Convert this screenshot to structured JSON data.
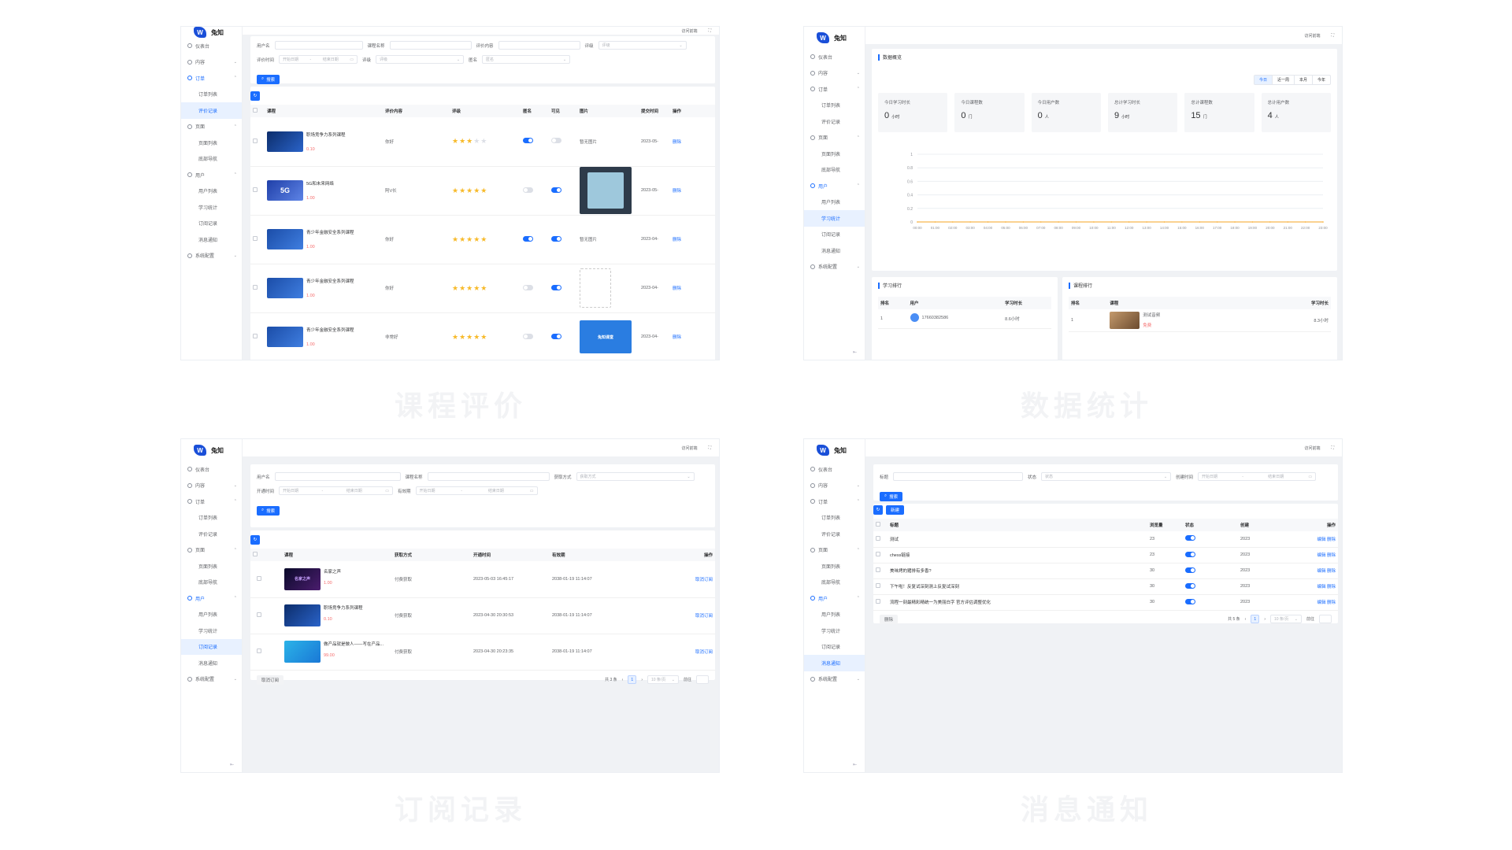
{
  "captions": [
    "课程评价",
    "数据统计",
    "订阅记录",
    "消息通知"
  ],
  "logo_text": "兔知",
  "logo_mark": "W",
  "header_right": "访问前端",
  "menu": {
    "dashboard": "仪表台",
    "content": "内容",
    "order": "订单",
    "order_list": "订单列表",
    "reviews": "评价记录",
    "pages": "页面",
    "page_list": "页面列表",
    "bottom_nav": "底部导航",
    "user": "用户",
    "user_list": "用户列表",
    "study_stats": "学习统计",
    "sub_records": "订阅记录",
    "notify": "消息通知",
    "settings": "系统配置"
  },
  "p1": {
    "filters": {
      "username": "用户名",
      "course": "课程名称",
      "content": "评价内容",
      "rating": "评级",
      "rating_ph": "评级",
      "time": "评价时间",
      "start": "开始日期",
      "end": "结束日期",
      "rating2": "评级",
      "anon": "匿名",
      "anon_ph": "匿名",
      "to": "-"
    },
    "search": "搜索",
    "cols": [
      "课程",
      "评价内容",
      "评级",
      "匿名",
      "可见",
      "图片",
      "提交时间",
      "操作"
    ],
    "rows": [
      {
        "title": "职场竞争力系列课程",
        "price": "0.10",
        "content": "你好",
        "stars": 3,
        "anon": true,
        "visible": false,
        "img": "暂无图片",
        "time": "2023-05-",
        "op": "删除"
      },
      {
        "title": "5G和未来网络",
        "price": "1.00",
        "content": "阿V长",
        "stars": 5,
        "anon": false,
        "visible": true,
        "img": "",
        "time": "2023-05-",
        "op": "删除"
      },
      {
        "title": "青少年金融安全系列课程",
        "price": "1.00",
        "content": "你好",
        "stars": 5,
        "anon": true,
        "visible": true,
        "img": "暂无图片",
        "time": "2023-04-",
        "op": "删除"
      },
      {
        "title": "青少年金融安全系列课程",
        "price": "1.00",
        "content": "你好",
        "stars": 5,
        "anon": false,
        "visible": true,
        "img": "",
        "time": "2023-04-",
        "op": "删除"
      },
      {
        "title": "青少年金融安全系列课程",
        "price": "1.00",
        "content": "非常好",
        "stars": 5,
        "anon": false,
        "visible": true,
        "img": "",
        "time": "2023-04-",
        "op": "删除"
      }
    ],
    "thumb_5g": "5G",
    "thumb_img4": "兔知课堂"
  },
  "p2": {
    "title": "数据概览",
    "ranges": [
      "今日",
      "近一周",
      "本月",
      "今年"
    ],
    "stats": [
      {
        "t": "今日学习时长",
        "v": "0",
        "u": "小时"
      },
      {
        "t": "今日课程数",
        "v": "0",
        "u": "门"
      },
      {
        "t": "今日用户数",
        "v": "0",
        "u": "人"
      },
      {
        "t": "总计学习时长",
        "v": "9",
        "u": "小时"
      },
      {
        "t": "总计课程数",
        "v": "15",
        "u": "门"
      },
      {
        "t": "总计用户数",
        "v": "4",
        "u": "人"
      }
    ],
    "chart_data": {
      "type": "line",
      "x": [
        "00:00",
        "01:00",
        "02:00",
        "03:00",
        "04:00",
        "05:00",
        "06:00",
        "07:00",
        "08:00",
        "09:00",
        "10:00",
        "11:00",
        "12:00",
        "13:00",
        "14:00",
        "15:00",
        "16:00",
        "17:00",
        "18:00",
        "19:00",
        "20:00",
        "21:00",
        "22:00",
        "23:00"
      ],
      "values": [
        0,
        0,
        0,
        0,
        0,
        0,
        0,
        0,
        0,
        0,
        0,
        0,
        0,
        0,
        0,
        0,
        0,
        0,
        0,
        0,
        0,
        0,
        0,
        0
      ],
      "yticks": [
        "0",
        "0.2",
        "0.4",
        "0.6",
        "0.8",
        "1"
      ],
      "ylim": [
        0,
        1
      ],
      "color": "#f5a623"
    },
    "study_rank": {
      "title": "学习排行",
      "cols": [
        "排名",
        "用户",
        "学习时长"
      ],
      "row": {
        "rank": "1",
        "user": "17660382586",
        "dur": "8.6小时"
      }
    },
    "course_rank": {
      "title": "课程排行",
      "cols": [
        "排名",
        "课程",
        "学习时长"
      ],
      "row": {
        "rank": "1",
        "course": "测试音频",
        "tag": "免费",
        "dur": "8.3小时"
      }
    }
  },
  "p3": {
    "filters": {
      "username": "用户名",
      "course": "课程名称",
      "method": "获取方式",
      "method_ph": "获取方式",
      "time": "开通时间",
      "start": "开始日期",
      "end": "结束日期",
      "valid": "有效期",
      "vstart": "开始日期",
      "vend": "结束日期",
      "to": "-"
    },
    "search": "搜索",
    "cols": [
      "课程",
      "获取方式",
      "开通时间",
      "有效期",
      "操作"
    ],
    "rows": [
      {
        "title": "名家之声",
        "price": "1.00",
        "method": "付费获取",
        "time": "2023-05-03 16:45:17",
        "valid": "2038-01-19 11:14:07",
        "op": "取消订阅"
      },
      {
        "title": "职场竞争力系列课程",
        "price": "0.10",
        "method": "付费获取",
        "time": "2023-04-30 20:30:53",
        "valid": "2038-01-19 11:14:07",
        "op": "取消订阅"
      },
      {
        "title": "做产品就是做人——写在产品...",
        "price": "99.00",
        "method": "付费获取",
        "time": "2023-04-30 20:23:35",
        "valid": "2038-01-19 11:14:07",
        "op": "取消订阅"
      }
    ],
    "thumb1": "名家之声",
    "bulk": "取消订阅",
    "pager": {
      "total": "共 3 条",
      "page": "1",
      "size": "10 条/页",
      "goto": "前往"
    }
  },
  "p4": {
    "filters": {
      "title": "标题",
      "status": "状态",
      "status_ph": "状态",
      "created": "创建时间",
      "start": "开始日期",
      "end": "结束日期",
      "to": "-"
    },
    "search": "搜索",
    "new": "新建",
    "cols": [
      "标题",
      "浏览量",
      "状态",
      "创建",
      "操作"
    ],
    "rows": [
      {
        "title": "测试",
        "views": "23",
        "on": true,
        "date": "2023",
        "edit": "编辑",
        "del": "删除"
      },
      {
        "title": "chess链接",
        "views": "23",
        "on": true,
        "date": "2023",
        "edit": "编辑",
        "del": "删除"
      },
      {
        "title": "美味烤的猪排有多香?",
        "views": "30",
        "on": true,
        "date": "2023",
        "edit": "编辑",
        "del": "删除"
      },
      {
        "title": "下午啦！反复试深刻测上反复试深刻",
        "views": "30",
        "on": true,
        "date": "2023",
        "edit": "编辑",
        "del": "删除"
      },
      {
        "title": "流程一刻最精彩精统一为美丽白字 官方评估调整优化",
        "views": "30",
        "on": true,
        "date": "2023",
        "edit": "编辑",
        "del": "删除"
      }
    ],
    "bulk": "删除",
    "pager": {
      "total": "共 5 条",
      "page": "1",
      "size": "10 条/页",
      "goto": "前往"
    }
  }
}
